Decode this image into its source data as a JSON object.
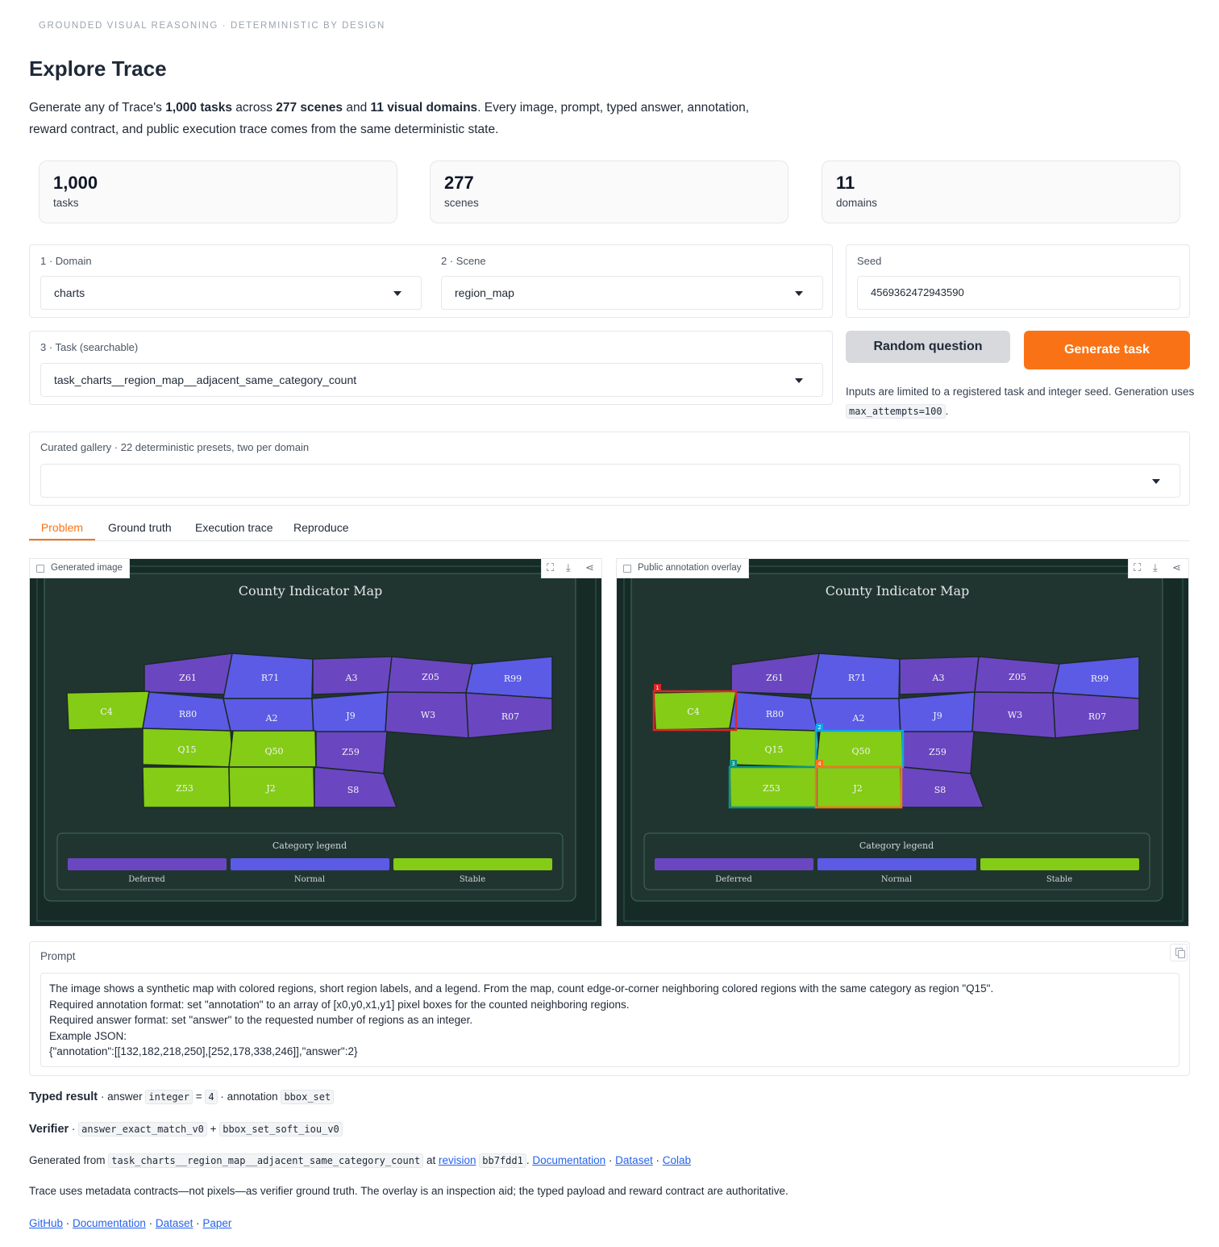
{
  "header": {
    "eyebrow": "GROUNDED VISUAL REASONING · DETERMINISTIC BY DESIGN",
    "title": "Explore Trace",
    "intro": {
      "p1": "Generate any of Trace's ",
      "b1": "1,000 tasks",
      "p2": " across ",
      "b2": "277 scenes",
      "p3": " and ",
      "b3": "11 visual domains",
      "p4": ". Every image, prompt, typed answer, annotation, reward contract, and public execution trace comes from the same deterministic state."
    }
  },
  "stats": [
    {
      "value": "1,000",
      "label": "tasks"
    },
    {
      "value": "277",
      "label": "scenes"
    },
    {
      "value": "11",
      "label": "domains"
    }
  ],
  "controls": {
    "domain": {
      "label": "1 · Domain",
      "value": "charts"
    },
    "scene": {
      "label": "2 · Scene",
      "value": "region_map"
    },
    "task": {
      "label": "3 · Task (searchable)",
      "value": "task_charts__region_map__adjacent_same_category_count"
    },
    "seed": {
      "label": "Seed",
      "value": "4569362472943590"
    },
    "random_button": "Random question",
    "generate_button": "Generate task",
    "note_text": "Inputs are limited to a registered task and integer seed. Generation uses ",
    "note_code": "max_attempts=100",
    "note_end": ".",
    "gallery": {
      "label": "Curated gallery · 22 deterministic presets, two per domain",
      "value": ""
    }
  },
  "tabs": [
    "Problem",
    "Ground truth",
    "Execution trace",
    "Reproduce"
  ],
  "images": {
    "left_tag": "Generated image",
    "right_tag": "Public annotation overlay"
  },
  "map": {
    "title": "County Indicator Map",
    "legend_title": "Category legend",
    "legend": [
      {
        "name": "Deferred",
        "color": "#6b46c1"
      },
      {
        "name": "Normal",
        "color": "#5b5be6"
      },
      {
        "name": "Stable",
        "color": "#84cc16"
      }
    ],
    "regions": [
      {
        "label": "Z61",
        "category": "Deferred"
      },
      {
        "label": "R71",
        "category": "Normal"
      },
      {
        "label": "A3",
        "category": "Deferred"
      },
      {
        "label": "Z05",
        "category": "Deferred"
      },
      {
        "label": "R99",
        "category": "Normal"
      },
      {
        "label": "C4",
        "category": "Stable"
      },
      {
        "label": "R80",
        "category": "Normal"
      },
      {
        "label": "A2",
        "category": "Normal"
      },
      {
        "label": "J9",
        "category": "Normal"
      },
      {
        "label": "W3",
        "category": "Deferred"
      },
      {
        "label": "R07",
        "category": "Deferred"
      },
      {
        "label": "Q15",
        "category": "Stable"
      },
      {
        "label": "Q50",
        "category": "Stable"
      },
      {
        "label": "Z59",
        "category": "Deferred"
      },
      {
        "label": "Z53",
        "category": "Stable"
      },
      {
        "label": "J2",
        "category": "Stable"
      },
      {
        "label": "S8",
        "category": "Deferred"
      }
    ],
    "overlay_boxes": [
      {
        "index": "1",
        "region": "C4",
        "color": "#dc2626"
      },
      {
        "index": "2",
        "region": "Q50",
        "color": "#0ea5e9"
      },
      {
        "index": "3",
        "region": "Z53",
        "color": "#0d9488"
      },
      {
        "index": "4",
        "region": "J2",
        "color": "#f97316"
      }
    ]
  },
  "prompt": {
    "label": "Prompt",
    "lines": [
      "The image shows a synthetic map with colored regions, short region labels, and a legend. From the map, count edge-or-corner neighboring colored regions with the same category as region \"Q15\".",
      "Required annotation format: set \"annotation\" to an array of [x0,y0,x1,y1] pixel boxes for the counted neighboring regions.",
      "Required answer format: set \"answer\" to the requested number of regions as an integer.",
      "Example JSON:",
      "{\"annotation\":[[132,182,218,250],[252,178,338,246]],\"answer\":2}"
    ]
  },
  "result": {
    "typed_label": "Typed result",
    "answer_word": " · answer ",
    "answer_type": "integer",
    "eq": " = ",
    "answer_value": "4",
    "annotation_word": " · annotation ",
    "annotation_type": "bbox_set",
    "verifier_label": "Verifier",
    "verifier_sep": " · ",
    "verifier_a": "answer_exact_match_v0",
    "plus": " + ",
    "verifier_b": "bbox_set_soft_iou_v0"
  },
  "provenance": {
    "generated_from": "Generated from ",
    "task_code": "task_charts__region_map__adjacent_same_category_count",
    "at": " at ",
    "revision_link": "revision",
    "revision_code": "bb7fdd1",
    "sep1": ". ",
    "documentation": "Documentation",
    "dot": " · ",
    "dataset": "Dataset",
    "colab": "Colab"
  },
  "disclaimer": "Trace uses metadata contracts—not pixels—as verifier ground truth. The overlay is an inspection aid; the typed payload and reward contract are authoritative.",
  "footer_links": [
    "GitHub",
    "Documentation",
    "Dataset",
    "Paper"
  ],
  "colors": {
    "accent": "#f97316",
    "map_bg": "#1e302b",
    "deferred": "#6b46c1",
    "normal": "#5b5be6",
    "stable": "#84cc16"
  }
}
